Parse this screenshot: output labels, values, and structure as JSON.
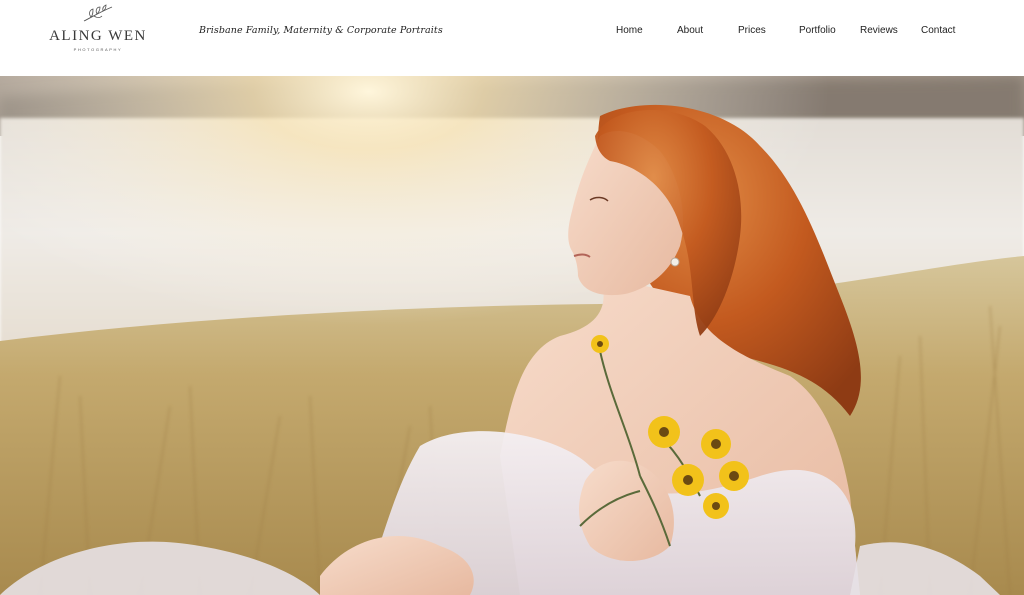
{
  "brand": {
    "name": "ALING WEN",
    "sub": "PHOTOGRAPHY",
    "tagline": "Brisbane Family, Maternity & Corporate Portraits",
    "logo_icon": "sprig-icon"
  },
  "nav": {
    "items": [
      {
        "label": "Home"
      },
      {
        "label": "About"
      },
      {
        "label": "Prices"
      },
      {
        "label": "Portfolio"
      },
      {
        "label": "Reviews"
      },
      {
        "label": "Contact"
      }
    ]
  },
  "hero": {
    "image": "red-haired-woman-in-meadow-with-yellow-flowers",
    "colors": {
      "hair": "#c35a1f",
      "grass": "#c2a56a",
      "water": "#eae6e0",
      "dress": "#ece6ea",
      "flower": "#f2c21a"
    }
  }
}
